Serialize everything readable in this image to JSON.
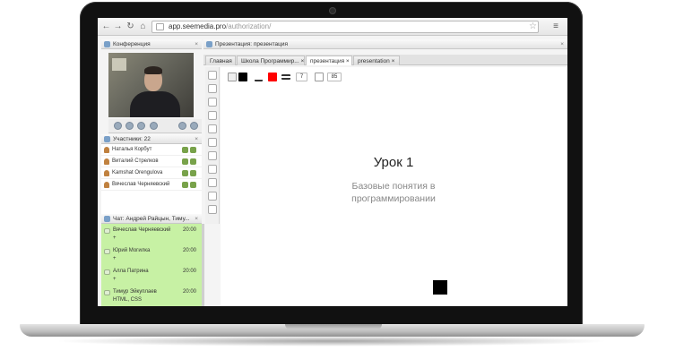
{
  "browser": {
    "url_host": "app.seemedia.pro",
    "url_path": "/authorization/"
  },
  "conference_panel": {
    "title": "Конференция"
  },
  "presentation_panel": {
    "title": "Презентация: презентация"
  },
  "tabs": [
    {
      "label": "Главная",
      "active": false
    },
    {
      "label": "Школа Программир...",
      "active": false
    },
    {
      "label": "презентация",
      "active": true
    },
    {
      "label": "presentation",
      "active": false
    }
  ],
  "participants": {
    "header": "Участники: 22",
    "items": [
      {
        "name": "Наталья Корбут"
      },
      {
        "name": "Виталий Стрелков"
      },
      {
        "name": "Kamshat Orengulova"
      },
      {
        "name": "Вячеслав Черняевский"
      }
    ]
  },
  "chat": {
    "header": "Чат: Андрей Райцын, Тиму...",
    "messages": [
      {
        "name": "Вячеслав Черняевский",
        "time": "20:00",
        "text": "+"
      },
      {
        "name": "Юрий Могилка",
        "time": "20:00",
        "text": "+"
      },
      {
        "name": "Алла Патрина",
        "time": "20:00",
        "text": "+"
      },
      {
        "name": "Тимур Эйкуплаев",
        "time": "20:00",
        "text": "HTML, CSS"
      }
    ]
  },
  "drawing_toolbar": {
    "line_width": "7",
    "size": "85"
  },
  "slide": {
    "title": "Урок 1",
    "subtitle_line1": "Базовые понятия в",
    "subtitle_line2": "программировании"
  },
  "colors": {
    "chat_bg": "#c7f1a4",
    "primary_color": "#ff0000",
    "secondary_color": "#000000"
  }
}
